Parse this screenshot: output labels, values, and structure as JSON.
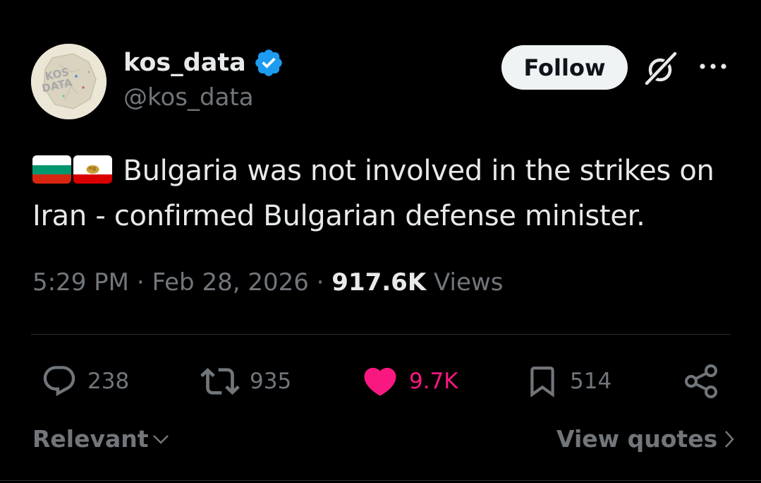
{
  "author": {
    "display_name": "kos_data",
    "handle": "@kos_data",
    "avatar_text_line1": "KOS",
    "avatar_text_line2": "DATA",
    "verified": true
  },
  "header": {
    "follow_label": "Follow"
  },
  "tweet": {
    "flags": [
      "bulgaria-flag",
      "iran-flag"
    ],
    "text": "Bulgaria was not involved in the strikes on Iran - confirmed Bulgarian defense minister.",
    "time": "5:29 PM",
    "date": "Feb 28, 2026",
    "separator": "·",
    "views_count": "917.6K",
    "views_label": "Views"
  },
  "actions": {
    "replies": "238",
    "reposts": "935",
    "likes": "9.7K",
    "bookmarks": "514"
  },
  "footer": {
    "sort_label": "Relevant",
    "view_quotes_label": "View quotes"
  },
  "colors": {
    "background": "#000000",
    "primary_text": "#e7e9ea",
    "secondary_text": "#71767b",
    "like_active": "#f91880",
    "verified_blue": "#1d9bf0"
  }
}
